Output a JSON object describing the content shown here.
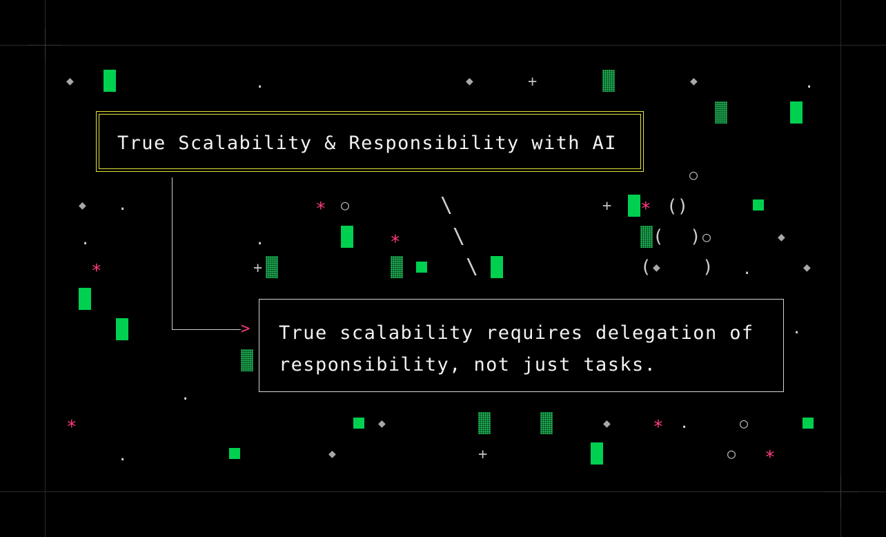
{
  "title": "True Scalability & Responsibility with AI",
  "quote": "True scalability requires delegation of responsibility, not just tasks.",
  "glyphs": {
    "diamond": "◆",
    "dot": ".",
    "plus": "+",
    "star": "*",
    "circle": "○",
    "backslash": "\\",
    "arrow": ">",
    "paren_pair": "()",
    "paren_open": "(",
    "paren_close": ")"
  },
  "colors": {
    "background": "#000000",
    "accent_green": "#00d050",
    "accent_pink": "#ff3b7f",
    "title_border": "#e6e63a",
    "text": "#f2f2f2"
  }
}
